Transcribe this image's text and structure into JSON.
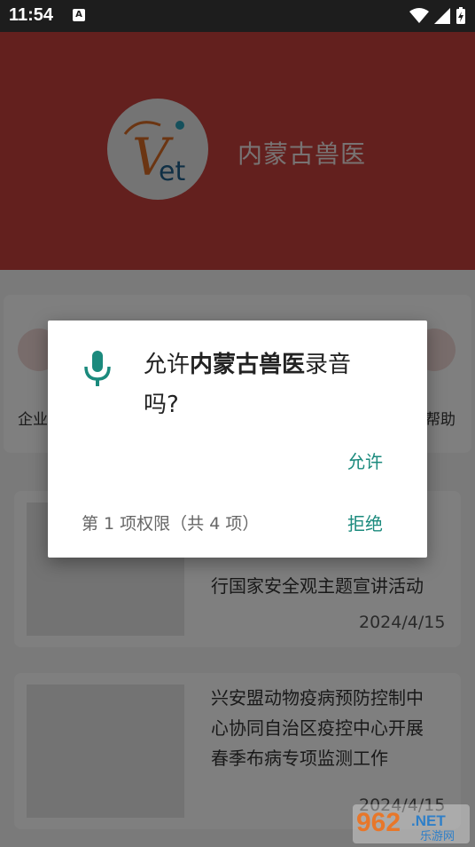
{
  "status_bar": {
    "time": "11:54",
    "notification_icon": "A"
  },
  "header": {
    "app_name": "内蒙古兽医",
    "logo_text": "Vet"
  },
  "menu": {
    "left_label": "企业",
    "right_label": "帮助"
  },
  "news": [
    {
      "lines": [
        "行国家安全观主题宣讲活动"
      ],
      "date": "2024/4/15"
    },
    {
      "lines": [
        "兴安盟动物疫病预防控制中",
        "心协同自治区疫控中心开展",
        "春季布病专项监测工作"
      ],
      "date": "2024/4/15"
    }
  ],
  "dialog": {
    "prefix": "允许",
    "app_name": "内蒙古兽医",
    "suffix": "录音",
    "line2": "吗?",
    "allow": "允许",
    "deny": "拒绝",
    "counter": "第 1 项权限（共 4 项）",
    "icon": "microphone-icon",
    "accent": "#1b8a7d"
  },
  "watermark": {
    "number": "962",
    "tld": ".NET",
    "cn": "乐游网"
  }
}
